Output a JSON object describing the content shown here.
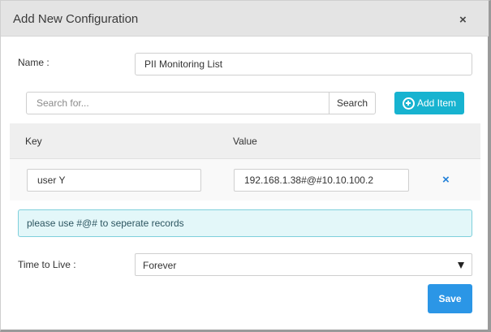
{
  "dialog": {
    "title": "Add New Configuration",
    "close_glyph": "×"
  },
  "name_field": {
    "label": "Name :",
    "value": "PII Monitoring List"
  },
  "search": {
    "placeholder": "Search for...",
    "button_label": "Search"
  },
  "add_item": {
    "label": "Add Item",
    "icon": "plus-circle-icon"
  },
  "table": {
    "columns": [
      "Key",
      "Value"
    ],
    "rows": [
      {
        "key": "user Y",
        "value": "192.168.1.38#@#10.10.100.2",
        "remove_glyph": "×"
      }
    ]
  },
  "info_message": "please use #@# to seperate records",
  "ttl": {
    "label": "Time to Live :",
    "selected": "Forever"
  },
  "save_button": {
    "label": "Save"
  },
  "colors": {
    "accent_cyan": "#17b3d0",
    "primary_blue": "#2b96e6",
    "remove_blue": "#2180d8",
    "info_bg": "#e3f7f9",
    "info_border": "#7fd0dc"
  }
}
